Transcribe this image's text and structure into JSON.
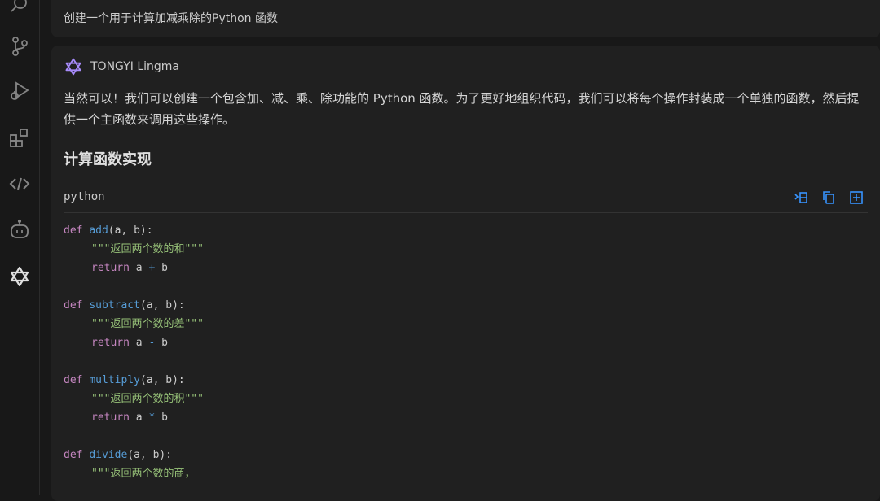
{
  "activity_bar": {
    "items": [
      {
        "icon": "search-icon"
      },
      {
        "icon": "source-control-icon"
      },
      {
        "icon": "run-debug-icon"
      },
      {
        "icon": "extensions-icon"
      },
      {
        "icon": "remote-icon"
      },
      {
        "icon": "copilot-icon"
      },
      {
        "icon": "tongyi-lingma-icon"
      }
    ]
  },
  "user_message": {
    "text": "创建一个用于计算加减乘除的Python 函数"
  },
  "assistant": {
    "name": "TONGYI Lingma",
    "intro": "当然可以！我们可以创建一个包含加、减、乘、除功能的 Python 函数。为了更好地组织代码，我们可以将每个操作封装成一个单独的函数，然后提供一个主函数来调用这些操作。",
    "section_title": "计算函数实现",
    "code_block": {
      "language": "python",
      "actions": [
        {
          "icon": "insert-at-cursor-icon"
        },
        {
          "icon": "copy-icon"
        },
        {
          "icon": "new-file-icon"
        }
      ],
      "functions": [
        {
          "keyword": "def",
          "name": "add",
          "params": "(a, b):",
          "doc": "\"\"\"返回两个数的和\"\"\"",
          "ret_kw": "return",
          "ret_a": "a",
          "op": "+",
          "ret_b": "b"
        },
        {
          "keyword": "def",
          "name": "subtract",
          "params": "(a, b):",
          "doc": "\"\"\"返回两个数的差\"\"\"",
          "ret_kw": "return",
          "ret_a": "a",
          "op": "-",
          "ret_b": "b"
        },
        {
          "keyword": "def",
          "name": "multiply",
          "params": "(a, b):",
          "doc": "\"\"\"返回两个数的积\"\"\"",
          "ret_kw": "return",
          "ret_a": "a",
          "op": "*",
          "ret_b": "b"
        },
        {
          "keyword": "def",
          "name": "divide",
          "params": "(a, b):",
          "doc": "\"\"\"返回两个数的商，"
        }
      ]
    }
  },
  "colors": {
    "keyword": "#c586c0",
    "function": "#569cd6",
    "string": "#98c379",
    "accent": "#3794ff"
  }
}
